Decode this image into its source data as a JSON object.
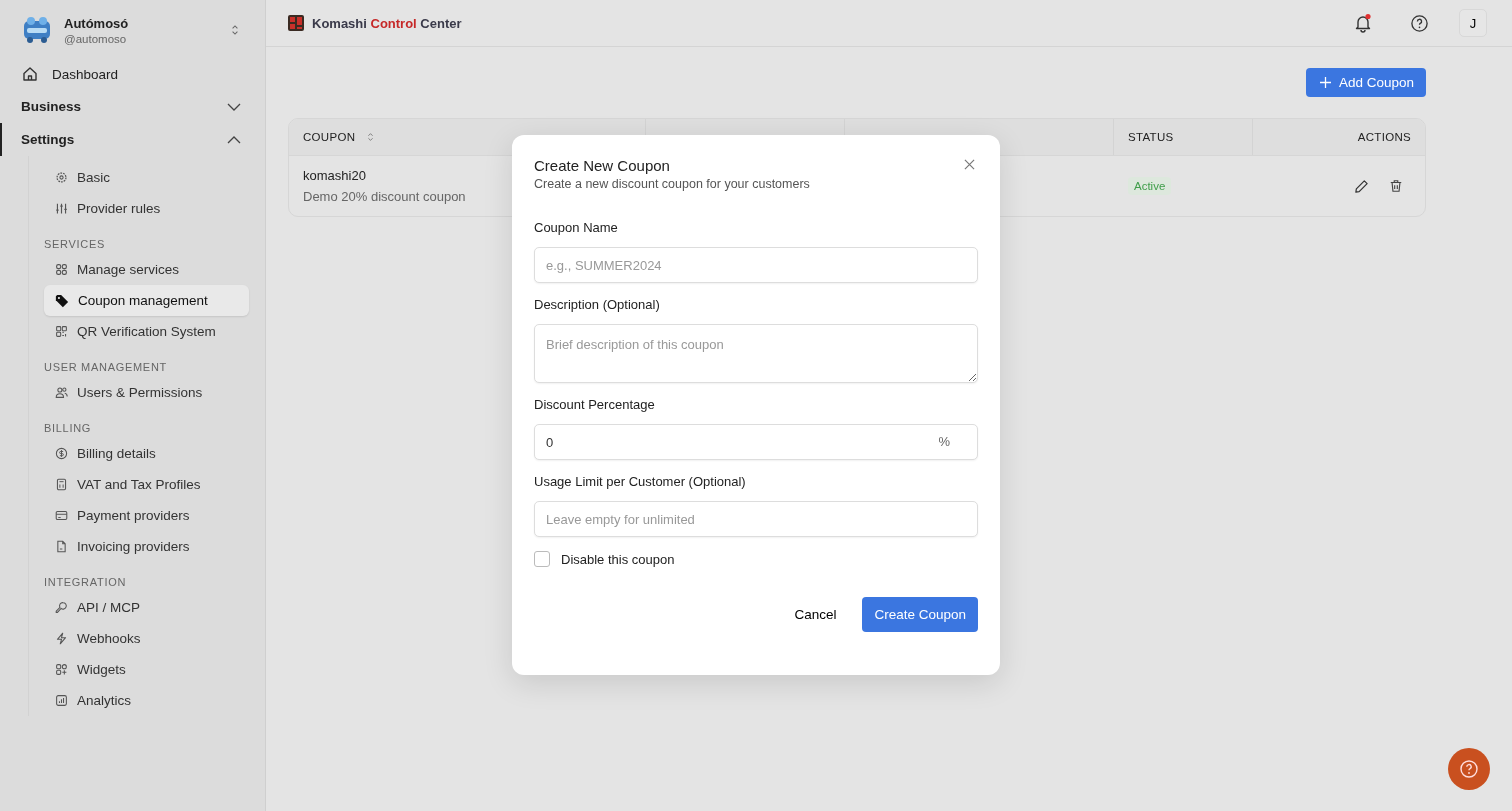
{
  "org": {
    "name": "Autómosó",
    "handle": "@automoso"
  },
  "nav": [
    {
      "label": "Dashboard",
      "kind": "link"
    },
    {
      "label": "Business",
      "kind": "group",
      "expanded": false
    },
    {
      "label": "Settings",
      "kind": "group",
      "expanded": true,
      "sections": [
        {
          "items": [
            {
              "label": "Basic",
              "selected": false
            },
            {
              "label": "Provider rules",
              "selected": false
            }
          ]
        },
        {
          "heading": "SERVICES",
          "items": [
            {
              "label": "Manage services",
              "selected": false
            },
            {
              "label": "Coupon management",
              "selected": true
            },
            {
              "label": "QR Verification System",
              "selected": false
            }
          ]
        },
        {
          "heading": "USER MANAGEMENT",
          "items": [
            {
              "label": "Users & Permissions",
              "selected": false
            }
          ]
        },
        {
          "heading": "BILLING",
          "items": [
            {
              "label": "Billing details",
              "selected": false
            },
            {
              "label": "VAT and Tax Profiles",
              "selected": false
            },
            {
              "label": "Payment providers",
              "selected": false
            },
            {
              "label": "Invoicing providers",
              "selected": false
            }
          ]
        },
        {
          "heading": "INTEGRATION",
          "items": [
            {
              "label": "API / MCP",
              "selected": false
            },
            {
              "label": "Webhooks",
              "selected": false
            },
            {
              "label": "Widgets",
              "selected": false
            },
            {
              "label": "Analytics",
              "selected": false
            }
          ]
        }
      ]
    }
  ],
  "brand": {
    "name": "Komashi",
    "accent": "Control",
    "suffix": "Center"
  },
  "topbar": {
    "unread_notifications": true,
    "avatar": "J"
  },
  "add_button": "Add Coupon",
  "table": {
    "columns": [
      {
        "label": "COUPON",
        "sortable": true
      },
      {
        "label": "STATUS",
        "sortable": false
      },
      {
        "label": "ACTIONS",
        "sortable": false
      }
    ],
    "rows": [
      {
        "name": "komashi20",
        "description": "Demo 20% discount coupon",
        "status": "Active"
      }
    ]
  },
  "dialog": {
    "title": "Create New Coupon",
    "subtitle": "Create a new discount coupon for your customers",
    "fields": [
      {
        "kind": "text",
        "label": "Coupon Name",
        "placeholder": "e.g., SUMMER2024"
      },
      {
        "kind": "textarea",
        "label": "Description (Optional)",
        "placeholder": "Brief description of this coupon"
      },
      {
        "kind": "number",
        "label": "Discount Percentage",
        "value": "0",
        "suffix": "%"
      },
      {
        "kind": "text",
        "label": "Usage Limit per Customer (Optional)",
        "placeholder": "Leave empty for unlimited"
      }
    ],
    "checkbox": {
      "label": "Disable this coupon",
      "checked": false
    },
    "cancel": "Cancel",
    "submit": "Create Coupon"
  }
}
